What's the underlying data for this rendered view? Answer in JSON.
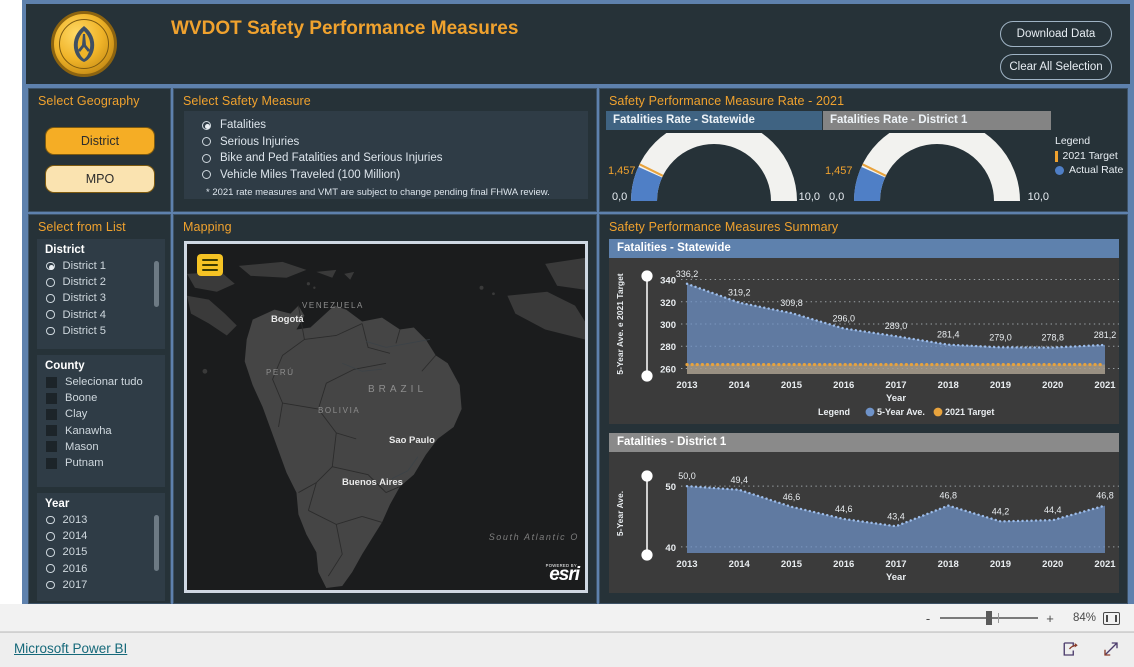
{
  "header": {
    "title": "WVDOT Safety Performance Measures",
    "logo_alt": "wv-dot-seal",
    "buttons": {
      "download": "Download Data",
      "clear": "Clear All Selection"
    }
  },
  "geography": {
    "title": "Select Geography",
    "options": [
      {
        "label": "District",
        "selected": true,
        "color": "#f5ad25"
      },
      {
        "label": "MPO",
        "selected": false,
        "color": "#fae3b0"
      }
    ]
  },
  "safety_measure": {
    "title": "Select Safety Measure",
    "options": [
      {
        "label": "Fatalities",
        "selected": true
      },
      {
        "label": "Serious Injuries",
        "selected": false
      },
      {
        "label": "Bike and Ped Fatalities and Serious Injuries",
        "selected": false
      },
      {
        "label": "Vehicle Miles Traveled (100 Million)",
        "selected": false
      }
    ],
    "note": "* 2021 rate measures and VMT are subject to change pending final FHWA review."
  },
  "gauges": {
    "title": "Safety Performance Measure Rate - 2021",
    "items": [
      {
        "tab": "Fatalities Rate - Statewide",
        "min": "0,0",
        "max": "10,0",
        "target": "1,457",
        "actual_value": 1.35,
        "target_value": 1.457,
        "scale_max": 10.0
      },
      {
        "tab": "Fatalities Rate - District 1",
        "min": "0,0",
        "max": "10,0",
        "target": "1,457",
        "actual_value": 1.35,
        "target_value": 1.457,
        "scale_max": 10.0
      }
    ],
    "legend": {
      "title": "Legend",
      "target_label": "2021 Target",
      "actual_label": "Actual Rate",
      "target_color": "#f0a22e",
      "actual_color": "#4f7fc6"
    }
  },
  "select_from_list": {
    "title": "Select from List",
    "groups": [
      {
        "name": "District",
        "type": "radio",
        "items": [
          {
            "label": "District 1",
            "selected": true
          },
          {
            "label": "District 2",
            "selected": false
          },
          {
            "label": "District 3",
            "selected": false
          },
          {
            "label": "District 4",
            "selected": false
          },
          {
            "label": "District 5",
            "selected": false
          }
        ]
      },
      {
        "name": "County",
        "type": "checkbox",
        "items": [
          {
            "label": "Selecionar tudo",
            "selected": false
          },
          {
            "label": "Boone",
            "selected": false
          },
          {
            "label": "Clay",
            "selected": false
          },
          {
            "label": "Kanawha",
            "selected": false
          },
          {
            "label": "Mason",
            "selected": false
          },
          {
            "label": "Putnam",
            "selected": false
          }
        ]
      },
      {
        "name": "Year",
        "type": "radio",
        "items": [
          {
            "label": "2013",
            "selected": false
          },
          {
            "label": "2014",
            "selected": false
          },
          {
            "label": "2015",
            "selected": false
          },
          {
            "label": "2016",
            "selected": false
          },
          {
            "label": "2017",
            "selected": false
          }
        ]
      }
    ]
  },
  "mapping": {
    "title": "Mapping",
    "menu_icon": "hamburger-menu-icon",
    "country_labels": [
      "VENEZUELA",
      "PERÚ",
      "BRAZIL",
      "BOLIVIA"
    ],
    "city_labels": [
      "Bogotá",
      "Sao Paulo",
      "Buenos Aires"
    ],
    "ocean_label": "South Atlantic O",
    "attribution": "esri",
    "attribution_sub": "POWERED BY"
  },
  "summary": {
    "title": "Safety Performance Measures Summary"
  },
  "chart_data": [
    {
      "type": "area",
      "title": "Fatalities - Statewide",
      "xlabel": "Year",
      "ylabel": "5-Year Ave. e 2021 Target",
      "categories": [
        "2013",
        "2014",
        "2015",
        "2016",
        "2017",
        "2018",
        "2019",
        "2020",
        "2021"
      ],
      "yticks": [
        260,
        280,
        300,
        320,
        340
      ],
      "ylim": [
        255,
        345
      ],
      "grid": true,
      "legend": {
        "position": "bottom",
        "title": "Legend",
        "entries": [
          "5-Year Ave.",
          "2021 Target"
        ]
      },
      "series": [
        {
          "name": "5-Year Ave.",
          "color": "#6f93c9",
          "values": [
            336.2,
            319.2,
            309.8,
            296.0,
            289.0,
            281.4,
            279.0,
            278.8,
            281.2
          ],
          "labels": [
            "336,2",
            "319,2",
            "309,8",
            "296,0",
            "289,0",
            "281,4",
            "279,0",
            "278,8",
            "281,2"
          ]
        },
        {
          "name": "2021 Target",
          "color": "#e8a33d",
          "constant": 263.5
        }
      ]
    },
    {
      "type": "area",
      "title": "Fatalities - District 1",
      "xlabel": "Year",
      "ylabel": "5-Year Ave.",
      "categories": [
        "2013",
        "2014",
        "2015",
        "2016",
        "2017",
        "2018",
        "2019",
        "2020",
        "2021"
      ],
      "yticks": [
        40,
        50
      ],
      "ylim": [
        39,
        52
      ],
      "grid": true,
      "legend": {
        "position": "none",
        "title": "",
        "entries": []
      },
      "series": [
        {
          "name": "5-Year Ave.",
          "color": "#6f93c9",
          "values": [
            50.0,
            49.4,
            46.6,
            44.6,
            43.4,
            46.8,
            44.2,
            44.4,
            46.8
          ],
          "labels": [
            "50,0",
            "49,4",
            "46,6",
            "44,6",
            "43,4",
            "46,8",
            "44,2",
            "44,4",
            "46,8"
          ]
        }
      ]
    }
  ],
  "statusbar": {
    "zoom_out": "-",
    "zoom_in": "+",
    "zoom_level": "84%",
    "fit_icon": "fit-to-page-icon"
  },
  "footer": {
    "link": "Microsoft Power BI",
    "share_icon": "share-icon",
    "fullscreen_icon": "fullscreen-icon"
  }
}
